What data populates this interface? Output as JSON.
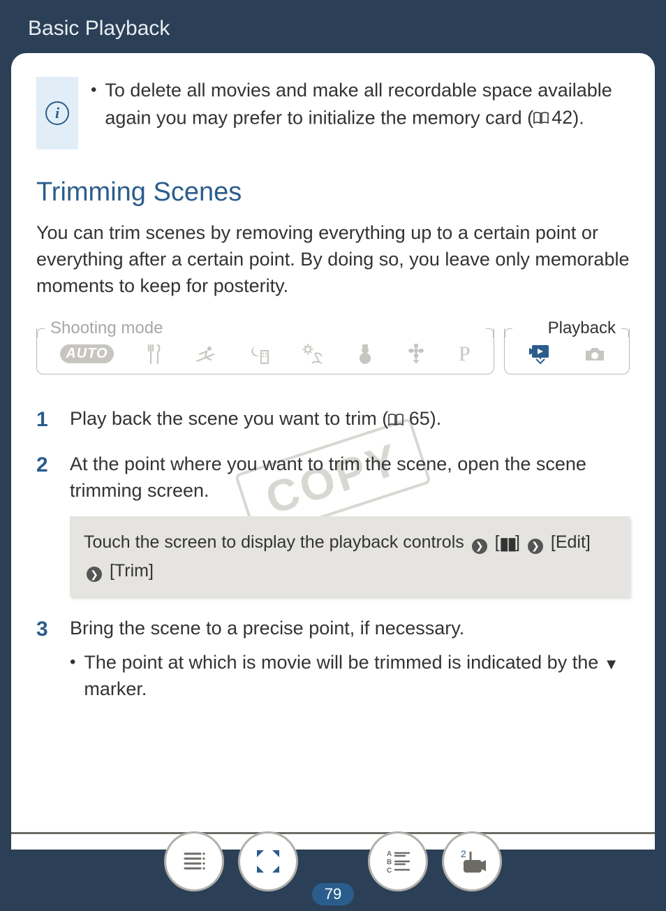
{
  "header": {
    "breadcrumb": "Basic Playback"
  },
  "info": {
    "bullet": "•",
    "text_pre": "To delete all movies and make all recordable space available again you may prefer to initialize the memory card (",
    "page_ref": "42",
    "text_post": ")."
  },
  "section": {
    "heading": "Trimming Scenes",
    "intro": "You can trim scenes by removing everything up to a certain point or everything after a certain point. By doing so, you leave only memorable moments to keep for posterity."
  },
  "mode": {
    "shoot_label": "Shooting mode",
    "play_label": "Playback",
    "auto": "AUTO",
    "p": "P"
  },
  "watermark": "COPY",
  "steps": {
    "s1_pre": "Play back the scene you want to trim (",
    "s1_ref": "65",
    "s1_post": ").",
    "s2": "At the point where you want to trim the scene, open the scene trimming screen.",
    "callout": {
      "pre": "Touch the screen to display the playback controls",
      "pause_open": "[",
      "pause_close": "]",
      "edit": "[Edit]",
      "trim": "[Trim]"
    },
    "s3": "Bring the scene to a precise point, if necessary.",
    "s3_sub_pre": "The point at which is movie will be trimmed is indicated by the ",
    "s3_sub_post": " marker."
  },
  "footer": {
    "page_number": "79",
    "badge_2": "2"
  }
}
